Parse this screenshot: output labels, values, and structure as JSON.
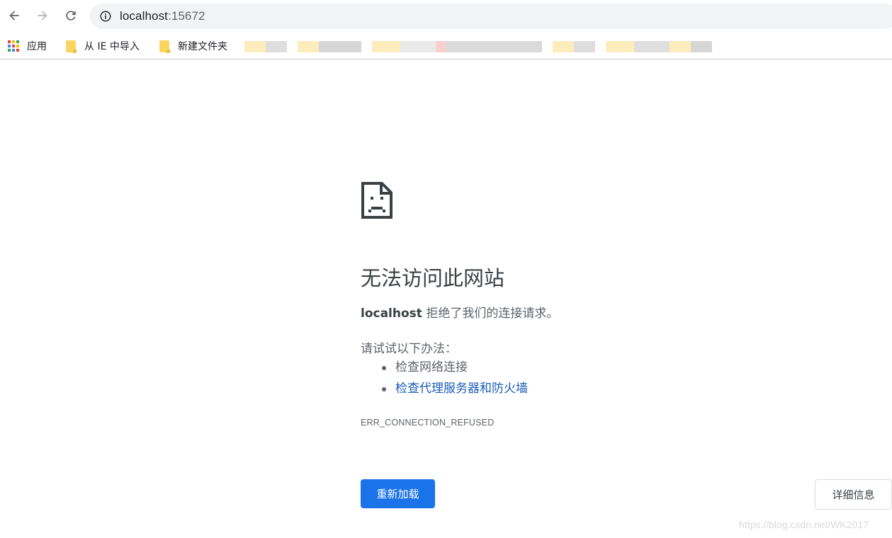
{
  "omnibox": {
    "host": "localhost",
    "port": ":15672"
  },
  "bookmarks": {
    "apps_label": "应用",
    "ie_import_label": "从 IE 中导入",
    "new_folder_label": "新建文件夹"
  },
  "error": {
    "title": "无法访问此网站",
    "host": "localhost",
    "message": " 拒绝了我们的连接请求。",
    "try_heading": "请试试以下办法：",
    "suggestions": [
      {
        "label": "检查网络连接"
      },
      {
        "label": "检查代理服务器和防火墙"
      }
    ],
    "code": "ERR_CONNECTION_REFUSED",
    "reload_label": "重新加载",
    "details_label": "详细信息"
  },
  "watermark": "https://blog.csdn.net/WK2017",
  "colors": {
    "accent": "#1a73e8",
    "link": "#1a5bb8",
    "text_secondary": "#5f6368"
  }
}
